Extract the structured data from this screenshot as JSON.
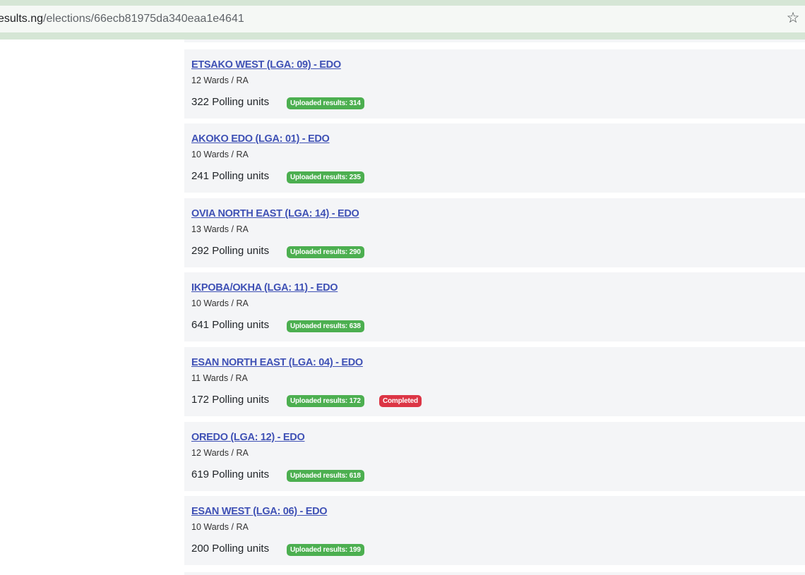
{
  "browser": {
    "url_host": "esults.ng",
    "url_path": "/elections/66ecb81975da340eaa1e4641",
    "star_icon": "star-icon"
  },
  "lgas": [
    {
      "title": "ETSAKO WEST (LGA: 09) - EDO",
      "wards": "12 Wards / RA",
      "units": "322 Polling units",
      "uploaded": "Uploaded results: 314",
      "completed": ""
    },
    {
      "title": "AKOKO EDO (LGA: 01) - EDO",
      "wards": "10 Wards / RA",
      "units": "241 Polling units",
      "uploaded": "Uploaded results: 235",
      "completed": ""
    },
    {
      "title": "OVIA NORTH EAST (LGA: 14) - EDO",
      "wards": "13 Wards / RA",
      "units": "292 Polling units",
      "uploaded": "Uploaded results: 290",
      "completed": ""
    },
    {
      "title": "IKPOBA/OKHA (LGA: 11) - EDO",
      "wards": "10 Wards / RA",
      "units": "641 Polling units",
      "uploaded": "Uploaded results: 638",
      "completed": ""
    },
    {
      "title": "ESAN NORTH EAST (LGA: 04) - EDO",
      "wards": "11 Wards / RA",
      "units": "172 Polling units",
      "uploaded": "Uploaded results: 172",
      "completed": "Completed"
    },
    {
      "title": "OREDO (LGA: 12) - EDO",
      "wards": "12 Wards / RA",
      "units": "619 Polling units",
      "uploaded": "Uploaded results: 618",
      "completed": ""
    },
    {
      "title": "ESAN WEST (LGA: 06) - EDO",
      "wards": "10 Wards / RA",
      "units": "200 Polling units",
      "uploaded": "Uploaded results: 199",
      "completed": ""
    }
  ],
  "colors": {
    "link": "#3f51b5",
    "badge_uploaded": "#4caf50",
    "badge_completed": "#dc3545",
    "card_bg": "#f4f5f7"
  }
}
